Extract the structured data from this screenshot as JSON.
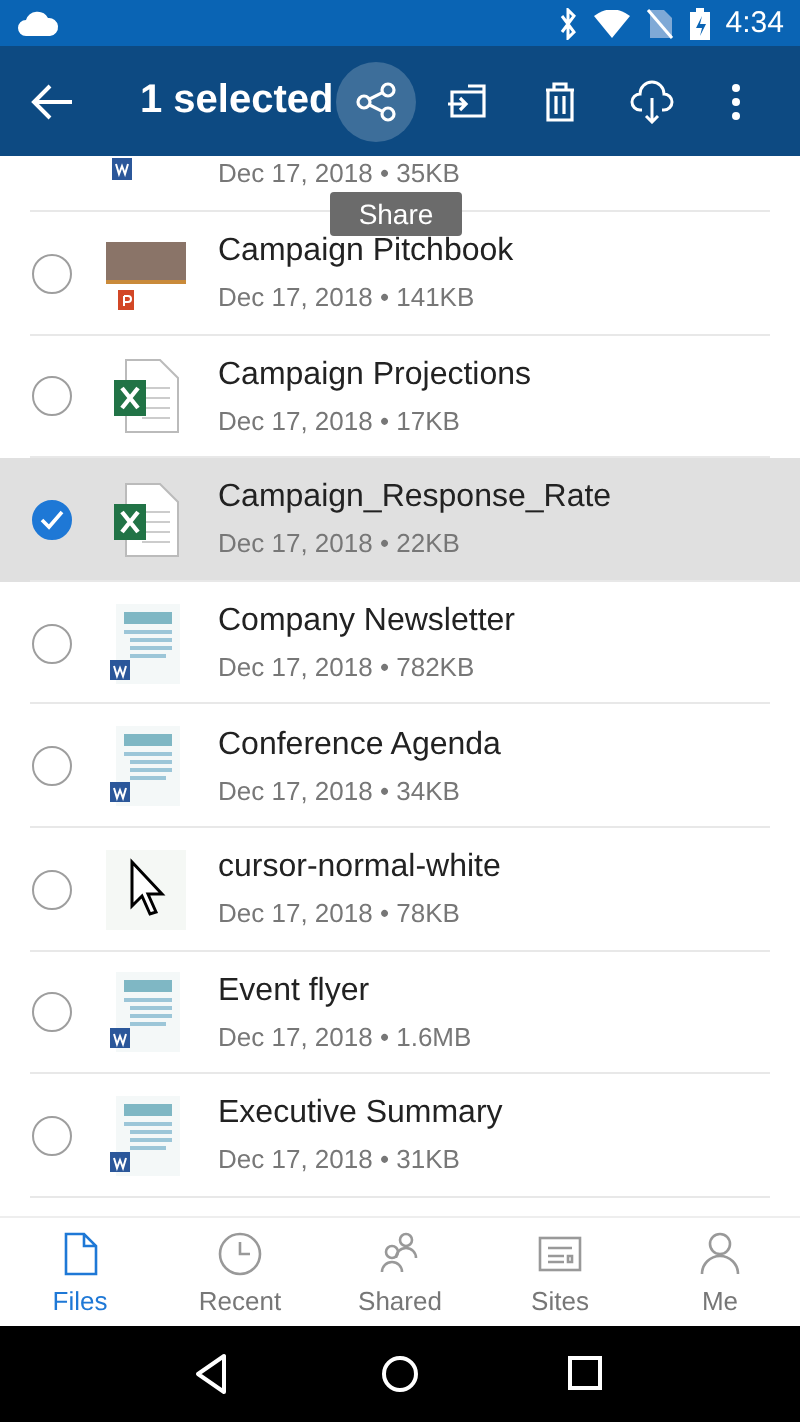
{
  "status_bar": {
    "time": "4:34"
  },
  "app_bar": {
    "title": "1 selected",
    "actions": [
      {
        "kind": "share",
        "pressed": true
      },
      {
        "kind": "move",
        "pressed": false
      },
      {
        "kind": "delete",
        "pressed": false
      },
      {
        "kind": "download",
        "pressed": false
      },
      {
        "kind": "more",
        "pressed": false
      }
    ]
  },
  "tooltip": "Share",
  "files": [
    {
      "kind": "word",
      "meta": "Dec 17, 2018 • 35KB"
    },
    {
      "kind": "powerpoint",
      "name": "Campaign Pitchbook",
      "meta": "Dec 17, 2018 • 141KB",
      "selected": false
    },
    {
      "kind": "excel",
      "name": "Campaign Projections",
      "meta": "Dec 17, 2018 • 17KB",
      "selected": false
    },
    {
      "kind": "excel",
      "name": "Campaign_Response_Rate",
      "meta": "Dec 17, 2018 • 22KB",
      "selected": true
    },
    {
      "kind": "word",
      "name": "Company Newsletter",
      "meta": "Dec 17, 2018 • 782KB",
      "selected": false
    },
    {
      "kind": "word",
      "name": "Conference Agenda",
      "meta": "Dec 17, 2018 • 34KB",
      "selected": false
    },
    {
      "kind": "image",
      "name": "cursor-normal-white",
      "meta": "Dec 17, 2018 • 78KB",
      "selected": false
    },
    {
      "kind": "word",
      "name": "Event flyer",
      "meta": "Dec 17, 2018 • 1.6MB",
      "selected": false
    },
    {
      "kind": "word",
      "name": "Executive Summary",
      "meta": "Dec 17, 2018 • 31KB",
      "selected": false
    }
  ],
  "bottom_tabs": [
    {
      "kind": "files",
      "label": "Files",
      "selected": true
    },
    {
      "kind": "recent",
      "label": "Recent",
      "selected": false
    },
    {
      "kind": "shared",
      "label": "Shared",
      "selected": false
    },
    {
      "kind": "sites",
      "label": "Sites",
      "selected": false
    },
    {
      "kind": "me",
      "label": "Me",
      "selected": false
    }
  ]
}
